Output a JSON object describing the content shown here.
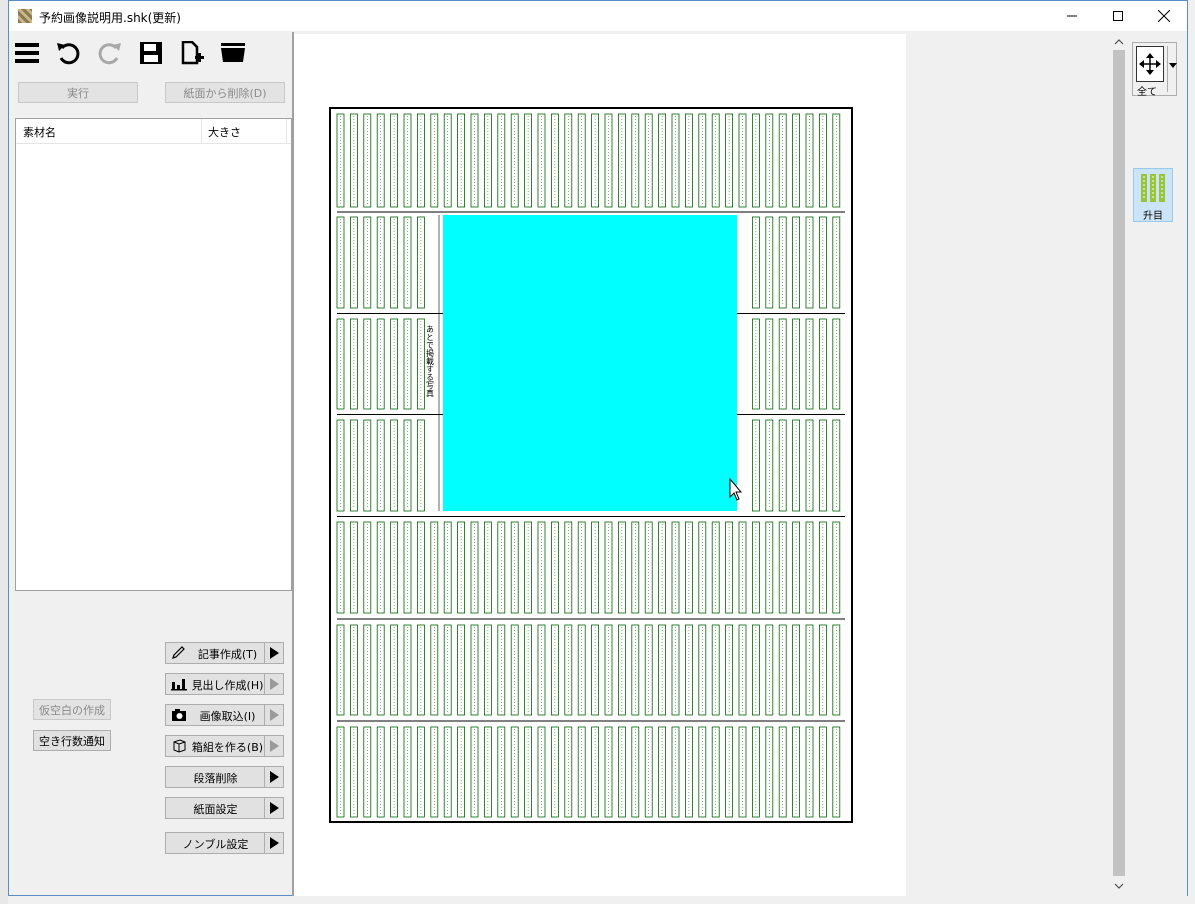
{
  "window": {
    "title": "予約画像説明用.shk(更新)"
  },
  "toolbar": {
    "icons": [
      "menu-icon",
      "undo-icon",
      "redo-icon",
      "save-icon",
      "new-file-icon",
      "open-folder-icon"
    ],
    "execute_label": "実行",
    "remove_from_page_label": "紙面から削除(D)"
  },
  "material_list": {
    "columns": [
      "素材名",
      "大きさ"
    ],
    "rows": []
  },
  "actions": {
    "create_article": "記事作成(T)",
    "create_headline": "見出し作成(H)",
    "import_image": "画像取込(I)",
    "make_box": "箱組を作る(B)",
    "delete_column": "段落削除",
    "page_settings": "紙面設定",
    "nombre_settings": "ノンブル設定",
    "create_temp_blank": "仮空白の作成",
    "notify_empty_lines": "空き行数通知"
  },
  "page": {
    "photo_placeholder_label": "あとで掲載する写真",
    "photo_color": "#00ffff",
    "grid_color": "#006400"
  },
  "right_panel": {
    "all_label": "全て",
    "masu_label": "升目"
  },
  "colors": {
    "window_border": "#5a8cc8",
    "selected_tool_bg": "#cce4f7"
  }
}
